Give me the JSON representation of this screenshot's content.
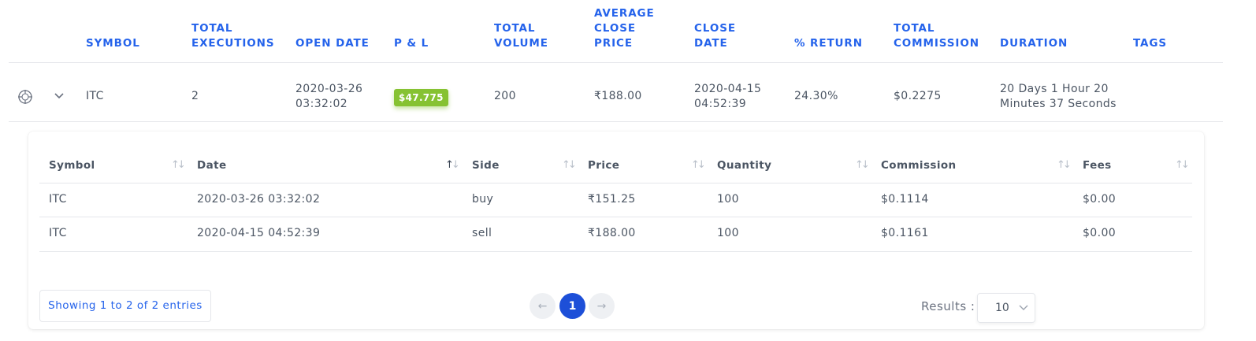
{
  "outer_table": {
    "columns": [
      {
        "label": "Symbol"
      },
      {
        "label": "Total\nExecutions"
      },
      {
        "label": "Open Date"
      },
      {
        "label": "P & L"
      },
      {
        "label": "Total\nVolume"
      },
      {
        "label": "Average\nClose\nPrice"
      },
      {
        "label": "Close\nDate"
      },
      {
        "label": "% Return"
      },
      {
        "label": "Total\nCommission"
      },
      {
        "label": "Duration"
      },
      {
        "label": "Tags"
      }
    ],
    "sort_glyph": "↑↓",
    "row": {
      "symbol": "ITC",
      "total_executions": "2",
      "open_date": "2020-03-26\n03:32:02",
      "pnl": "$47.775",
      "total_volume": "200",
      "avg_close_price": "₹188.00",
      "close_date": "2020-04-15\n04:52:39",
      "return_pct": "24.30%",
      "total_commission": "$0.2275",
      "duration": "20 Days 1 Hour 20\nMinutes 37 Seconds",
      "tags": ""
    }
  },
  "inner_table": {
    "columns": [
      "Symbol",
      "Date",
      "Side",
      "Price",
      "Quantity",
      "Commission",
      "Fees"
    ],
    "rows": [
      [
        "ITC",
        "2020-03-26 03:32:02",
        "buy",
        "₹151.25",
        "100",
        "$0.1114",
        "$0.00"
      ],
      [
        "ITC",
        "2020-04-15 04:52:39",
        "sell",
        "₹188.00",
        "100",
        "$0.1161",
        "$0.00"
      ]
    ]
  },
  "footer": {
    "showing": "Showing 1 to 2 of 2 entries",
    "prev_glyph": "←",
    "current_page": "1",
    "next_glyph": "→",
    "results_label": "Results :",
    "results_value": "10"
  },
  "colors": {
    "accent": "#2563eb",
    "profit_badge": "#86c232",
    "current_page": "#1d4fd8"
  }
}
